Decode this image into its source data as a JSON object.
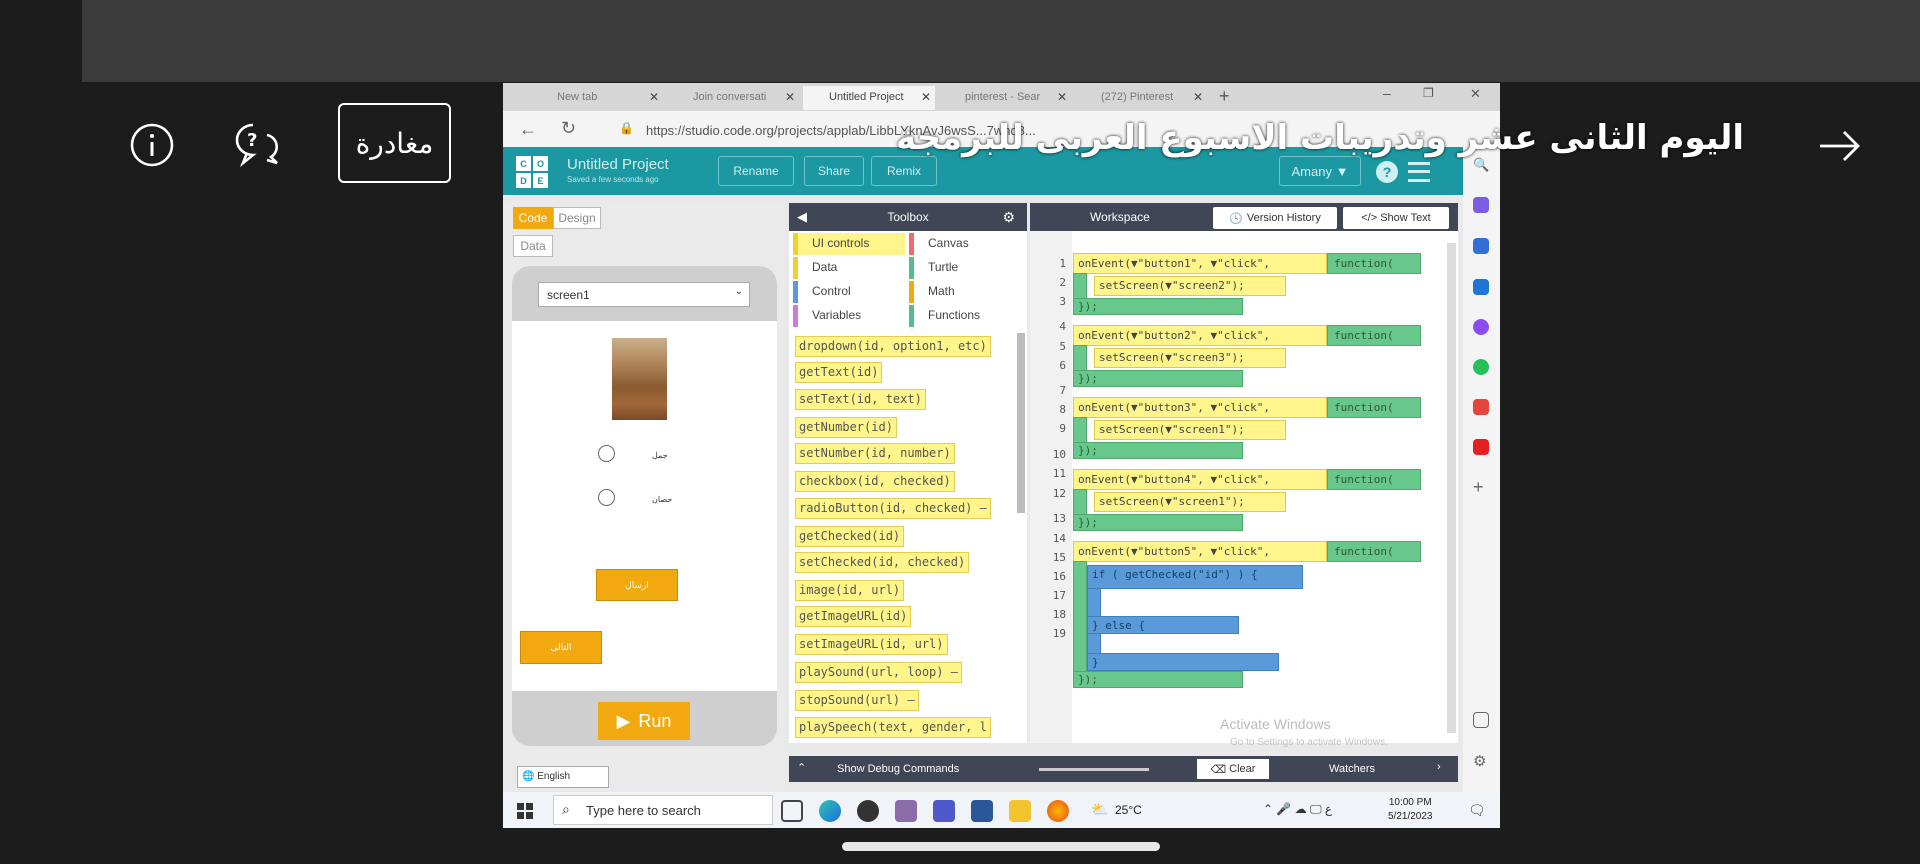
{
  "meeting": {
    "title": "اليوم الثانى عشر وتدريبات الاسبوع العربى للبرمجة",
    "leave_label": "مغادرة",
    "icons": [
      "info-icon",
      "chat-help-icon",
      "back-arrow-icon"
    ]
  },
  "browser": {
    "tabs": [
      {
        "label": "New tab"
      },
      {
        "label": "Join conversati"
      },
      {
        "label": "Untitled Project"
      },
      {
        "label": "pinterest - Sear"
      },
      {
        "label": "(272) Pinterest"
      }
    ],
    "url": "https://studio.code.org/projects/applab/LibbLYknAvJ6wsS...7whd8..."
  },
  "codeorg": {
    "logo": [
      "C",
      "O",
      "D",
      "E"
    ],
    "project_title": "Untitled Project",
    "saved_text": "Saved a few seconds ago",
    "rename": "Rename",
    "share": "Share",
    "remix": "Remix",
    "user": "Amany ▼",
    "help": "?"
  },
  "app": {
    "tab_code": "Code",
    "tab_design": "Design",
    "tab_data": "Data",
    "screen_select": "screen1",
    "radio1_label": "جمل",
    "radio2_label": "حصان",
    "send_button": "ارسال",
    "next_button": "التالى",
    "run_label": "Run",
    "language": "English"
  },
  "toolbox": {
    "title": "Toolbox",
    "categories": [
      {
        "label": "UI controls",
        "color": "#f5cd2f"
      },
      {
        "label": "Canvas",
        "color": "#ef6a6a"
      },
      {
        "label": "Data",
        "color": "#f5cd2f"
      },
      {
        "label": "Turtle",
        "color": "#4fc08a"
      },
      {
        "label": "Control",
        "color": "#5b9ad9"
      },
      {
        "label": "Math",
        "color": "#f1a90f"
      },
      {
        "label": "Variables",
        "color": "#c77fd1"
      },
      {
        "label": "Functions",
        "color": "#4fc08a"
      }
    ],
    "blocks": [
      "dropdown(id, option1, etc)",
      "getText(id)",
      "setText(id, text)",
      "getNumber(id)",
      "setNumber(id, number)",
      "checkbox(id, checked)",
      "radioButton(id, checked) —",
      "getChecked(id)",
      "setChecked(id, checked)",
      "image(id, url)",
      "getImageURL(id)",
      "setImageURL(id, url)",
      "playSound(url, loop) —",
      "stopSound(url) —",
      "playSpeech(text, gender, l"
    ]
  },
  "workspace": {
    "title": "Workspace",
    "version_history": "Version History",
    "show_text": "</> Show Text",
    "line_numbers": [
      "1",
      "2",
      "3",
      "4",
      "5",
      "6",
      "7",
      "8",
      "9",
      "10",
      "11",
      "12",
      "13",
      "14",
      "15",
      "16",
      "17",
      "18",
      "19"
    ],
    "events": [
      {
        "on": "onEvent(▼\"button1\", ▼\"click\",",
        "inner": "setScreen(▼\"screen2\");"
      },
      {
        "on": "onEvent(▼\"button2\", ▼\"click\",",
        "inner": "setScreen(▼\"screen3\");"
      },
      {
        "on": "onEvent(▼\"button3\", ▼\"click\",",
        "inner": "setScreen(▼\"screen1\");"
      },
      {
        "on": "onEvent(▼\"button4\", ▼\"click\",",
        "inner": "setScreen(▼\"screen1\");"
      },
      {
        "on": "onEvent(▼\"button5\", ▼\"click\","
      }
    ],
    "function_label": "function(",
    "close_label": "});",
    "if_label": "if ( getChecked(\"id\") ) {",
    "else_label": "} else {",
    "end_if": "}",
    "watermark1": "Activate Windows",
    "watermark2": "Go to Settings to activate Windows."
  },
  "debug": {
    "show_debug": "Show Debug Commands",
    "clear": "Clear",
    "watchers": "Watchers"
  },
  "taskbar": {
    "search_placeholder": "Type here to search",
    "weather": "25°C",
    "time": "10:00 PM",
    "date": "5/21/2023"
  }
}
